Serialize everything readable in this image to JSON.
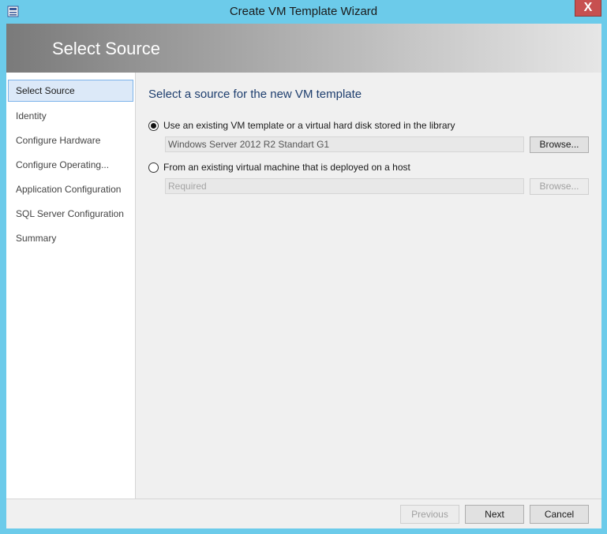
{
  "window": {
    "title": "Create VM Template Wizard",
    "close_label": "X",
    "app_icon": "wizard-window-icon"
  },
  "banner": {
    "title": "Select Source"
  },
  "sidebar": {
    "items": [
      {
        "label": "Select Source",
        "active": true
      },
      {
        "label": "Identity",
        "active": false
      },
      {
        "label": "Configure Hardware",
        "active": false
      },
      {
        "label": "Configure Operating...",
        "active": false
      },
      {
        "label": "Application Configuration",
        "active": false
      },
      {
        "label": "SQL Server Configuration",
        "active": false
      },
      {
        "label": "Summary",
        "active": false
      }
    ]
  },
  "main": {
    "heading": "Select a source for the new VM template",
    "option_library": {
      "label": "Use an existing VM template or a virtual hard disk stored in the library",
      "selected": true,
      "value": "Windows Server 2012 R2 Standart G1",
      "browse_label": "Browse..."
    },
    "option_host": {
      "label": "From an existing virtual machine that is deployed on a host",
      "selected": false,
      "placeholder": "Required",
      "browse_label": "Browse..."
    }
  },
  "footer": {
    "previous_label": "Previous",
    "next_label": "Next",
    "cancel_label": "Cancel"
  },
  "colors": {
    "frame": "#6ccbea",
    "close": "#c75050",
    "heading": "#1e3e6e",
    "active_item": "#dce9f8"
  }
}
